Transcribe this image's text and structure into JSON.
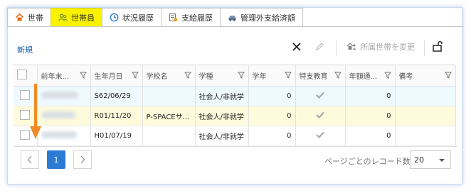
{
  "tabs": [
    {
      "label": "世帯",
      "icon": "home-icon",
      "active": false
    },
    {
      "label": "世帯員",
      "icon": "users-icon",
      "active": true
    },
    {
      "label": "状況履歴",
      "icon": "clock-icon",
      "active": false
    },
    {
      "label": "支給履歴",
      "icon": "ledger-icon",
      "active": false
    },
    {
      "label": "管理外支給済額",
      "icon": "car-icon",
      "active": false
    }
  ],
  "toolbar": {
    "new_label": "新規",
    "assign_label": "所属世帯を変更"
  },
  "grid": {
    "columns": [
      "前年末...",
      "生年月日",
      "学校名",
      "学種",
      "学年",
      "特支教育",
      "年額通...",
      "備考"
    ],
    "rows": [
      {
        "birth": "S62/06/29",
        "school": "",
        "type": "社会人/非就学",
        "grade": "0",
        "special": true,
        "annual": "0",
        "note": ""
      },
      {
        "birth": "R01/11/20",
        "school": "P-SPACEサ...",
        "type": "社会人/非就学",
        "grade": "0",
        "special": true,
        "annual": "0",
        "note": ""
      },
      {
        "birth": "H01/07/19",
        "school": "",
        "type": "社会人/非就学",
        "grade": "0",
        "special": true,
        "annual": "0",
        "note": ""
      }
    ]
  },
  "pager": {
    "current_page": "1",
    "page_size_label": "ページごとのレコード数",
    "page_size": "20"
  },
  "colors": {
    "active_tab": "#fbf200",
    "accent": "#2b7bd4",
    "annotation_arrow": "#f08a24",
    "row_tint_1": "#eefaff",
    "row_tint_2": "#fdfbdc"
  }
}
